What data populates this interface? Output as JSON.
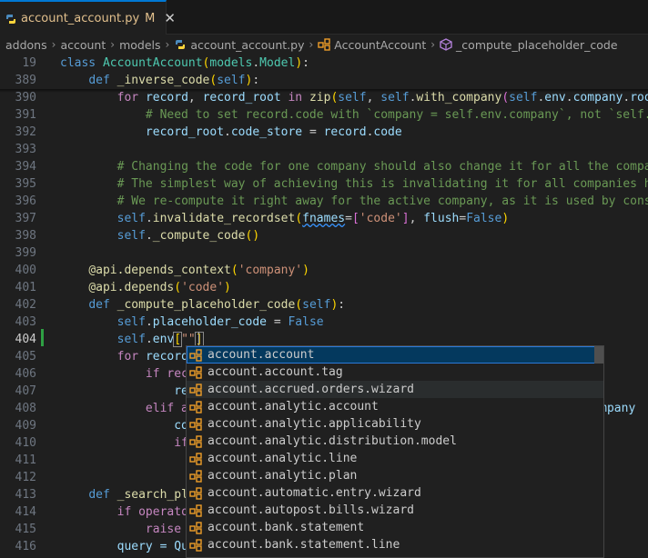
{
  "tab": {
    "filename": "account_account.py",
    "status": "M",
    "close": "✕"
  },
  "breadcrumb": [
    "addons",
    "account",
    "models",
    "account_account.py",
    "AccountAccount",
    "_compute_placeholder_code"
  ],
  "lines": {
    "l19": "19",
    "l389": "389",
    "l390": "390",
    "l391": "391",
    "l392": "392",
    "l393": "393",
    "l394": "394",
    "l395": "395",
    "l396": "396",
    "l397": "397",
    "l398": "398",
    "l399": "399",
    "l400": "400",
    "l401": "401",
    "l402": "402",
    "l403": "403",
    "l404": "404",
    "l405": "405",
    "l406": "406",
    "l407": "407",
    "l408": "408",
    "l409": "409",
    "l410": "410",
    "l411": "411",
    "l412": "412",
    "l413": "413",
    "l414": "414",
    "l415": "415",
    "l416": "416"
  },
  "code": {
    "c391": "# Need to set record.code with `company = self.env.company`, not `self.e",
    "c394": "# Changing the code for one company should also change it for all the compan",
    "c395": "# The simplest way of achieving this is invalidating it for all companies he",
    "c396": "# We re-compute it right away for the active company, as it is used by const",
    "s400": "'company'",
    "s401": "'code'",
    "s397": "'code'",
    "frag405": "if rec",
    "frag406": "re",
    "frag408a": "elif a",
    "frag408b": "es.company",
    "frag409": "co",
    "frag410": "if",
    "frag413": "_search_pl",
    "frag414": "if operato",
    "frag415": "raise",
    "frag416": "query = Qu"
  },
  "suggestions": [
    "account.account",
    "account.account.tag",
    "account.accrued.orders.wizard",
    "account.analytic.account",
    "account.analytic.applicability",
    "account.analytic.distribution.model",
    "account.analytic.line",
    "account.analytic.plan",
    "account.automatic.entry.wizard",
    "account.autopost.bills.wizard",
    "account.bank.statement",
    "account.bank.statement.line"
  ],
  "icon": "python-file-icon",
  "colors": {
    "accent": "#0078d4",
    "keyword": "#569cd6",
    "string": "#ce9178",
    "comment": "#6a9955",
    "class": "#4ec9b0",
    "function": "#dcdcaa"
  }
}
